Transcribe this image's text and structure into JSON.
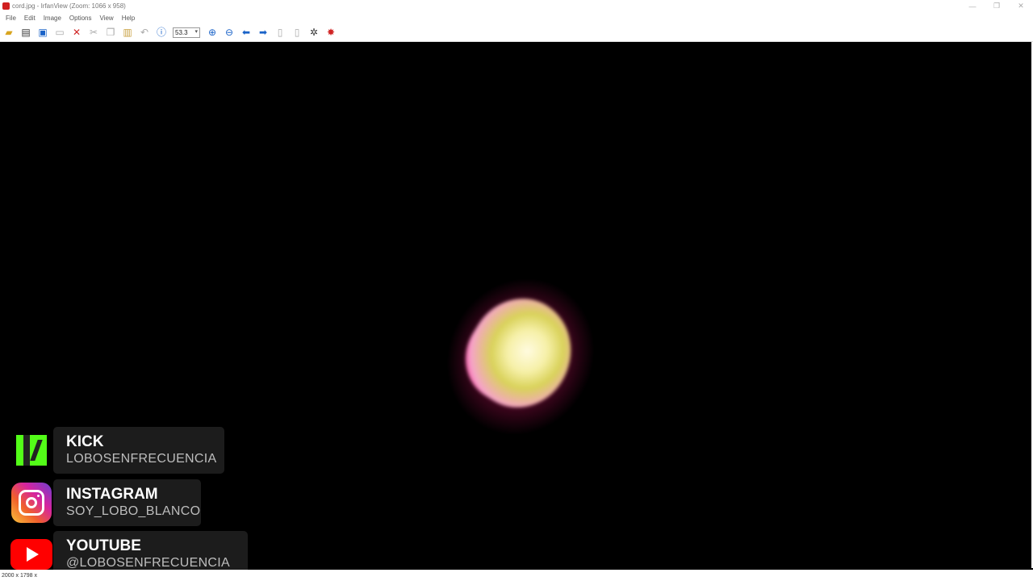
{
  "window": {
    "title": "cord.jpg - IrfanView (Zoom: 1066 x 958)",
    "controls": [
      "—",
      "❐",
      "✕"
    ]
  },
  "menu": {
    "items": [
      "File",
      "Edit",
      "Image",
      "Options",
      "View",
      "Help"
    ]
  },
  "toolbar": {
    "zoom_value": "53.3"
  },
  "statusbar": {
    "text": "2000 x 1798 x"
  },
  "overlay": {
    "kick": {
      "name": "KICK",
      "handle": "LOBOSENFRECUENCIA"
    },
    "instagram": {
      "name": "INSTAGRAM",
      "handle": "SOY_LOBO_BLANCO"
    },
    "youtube": {
      "name": "YOUTUBE",
      "handle": "@LOBOSENFRECUENCIA"
    }
  },
  "colors": {
    "kick_green": "#53fc18",
    "youtube_red": "#ff0000",
    "glow_magenta": "#ff2a9a"
  }
}
